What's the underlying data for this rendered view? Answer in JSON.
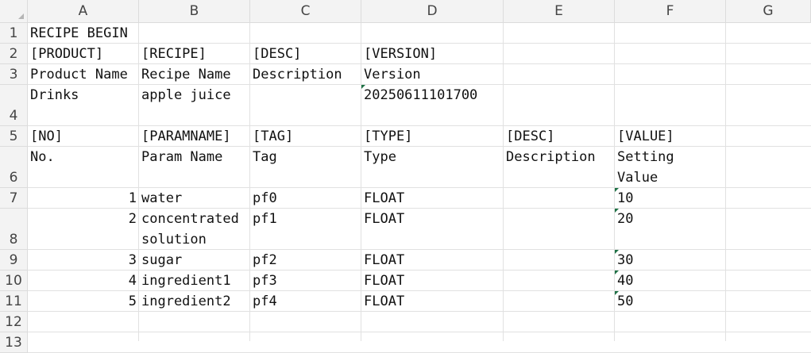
{
  "columns": [
    "A",
    "B",
    "C",
    "D",
    "E",
    "F",
    "G"
  ],
  "rows": [
    "1",
    "2",
    "3",
    "4",
    "5",
    "6",
    "7",
    "8",
    "9",
    "10",
    "11",
    "12",
    "13"
  ],
  "cells": {
    "A1": "RECIPE BEGIN",
    "A2": "[PRODUCT]",
    "B2": "[RECIPE]",
    "C2": "[DESC]",
    "D2": "[VERSION]",
    "A3": "Product Name",
    "B3": "Recipe Name",
    "C3": "Description",
    "D3": "Version",
    "A4": "Drinks",
    "B4": "apple juice",
    "D4": "20250611101700",
    "A5": "[NO]",
    "B5": "[PARAMNAME]",
    "C5": "[TAG]",
    "D5": "[TYPE]",
    "E5": "[DESC]",
    "F5": "[VALUE]",
    "A6": "No.",
    "B6": "Param Name",
    "C6": "Tag",
    "D6": "Type",
    "E6": "Description",
    "F6": "Setting\nValue",
    "A7": "1",
    "B7": "water",
    "C7": "pf0",
    "D7": "FLOAT",
    "F7": "10",
    "A8": "2",
    "B8": "concentrated\nsolution",
    "C8": "pf1",
    "D8": "FLOAT",
    "F8": "20",
    "A9": "3",
    "B9": "sugar",
    "C9": "pf2",
    "D9": "FLOAT",
    "F9": "30",
    "A10": "4",
    "B10": "ingredient1",
    "C10": "pf3",
    "D10": "FLOAT",
    "F10": "40",
    "A11": "5",
    "B11": "ingredient2",
    "C11": "pf4",
    "D11": "FLOAT",
    "F11": "50"
  },
  "text_stored_as_number_cells": [
    "D4",
    "F7",
    "F8",
    "F9",
    "F10",
    "F11"
  ],
  "indicator_color": "#1e7145"
}
